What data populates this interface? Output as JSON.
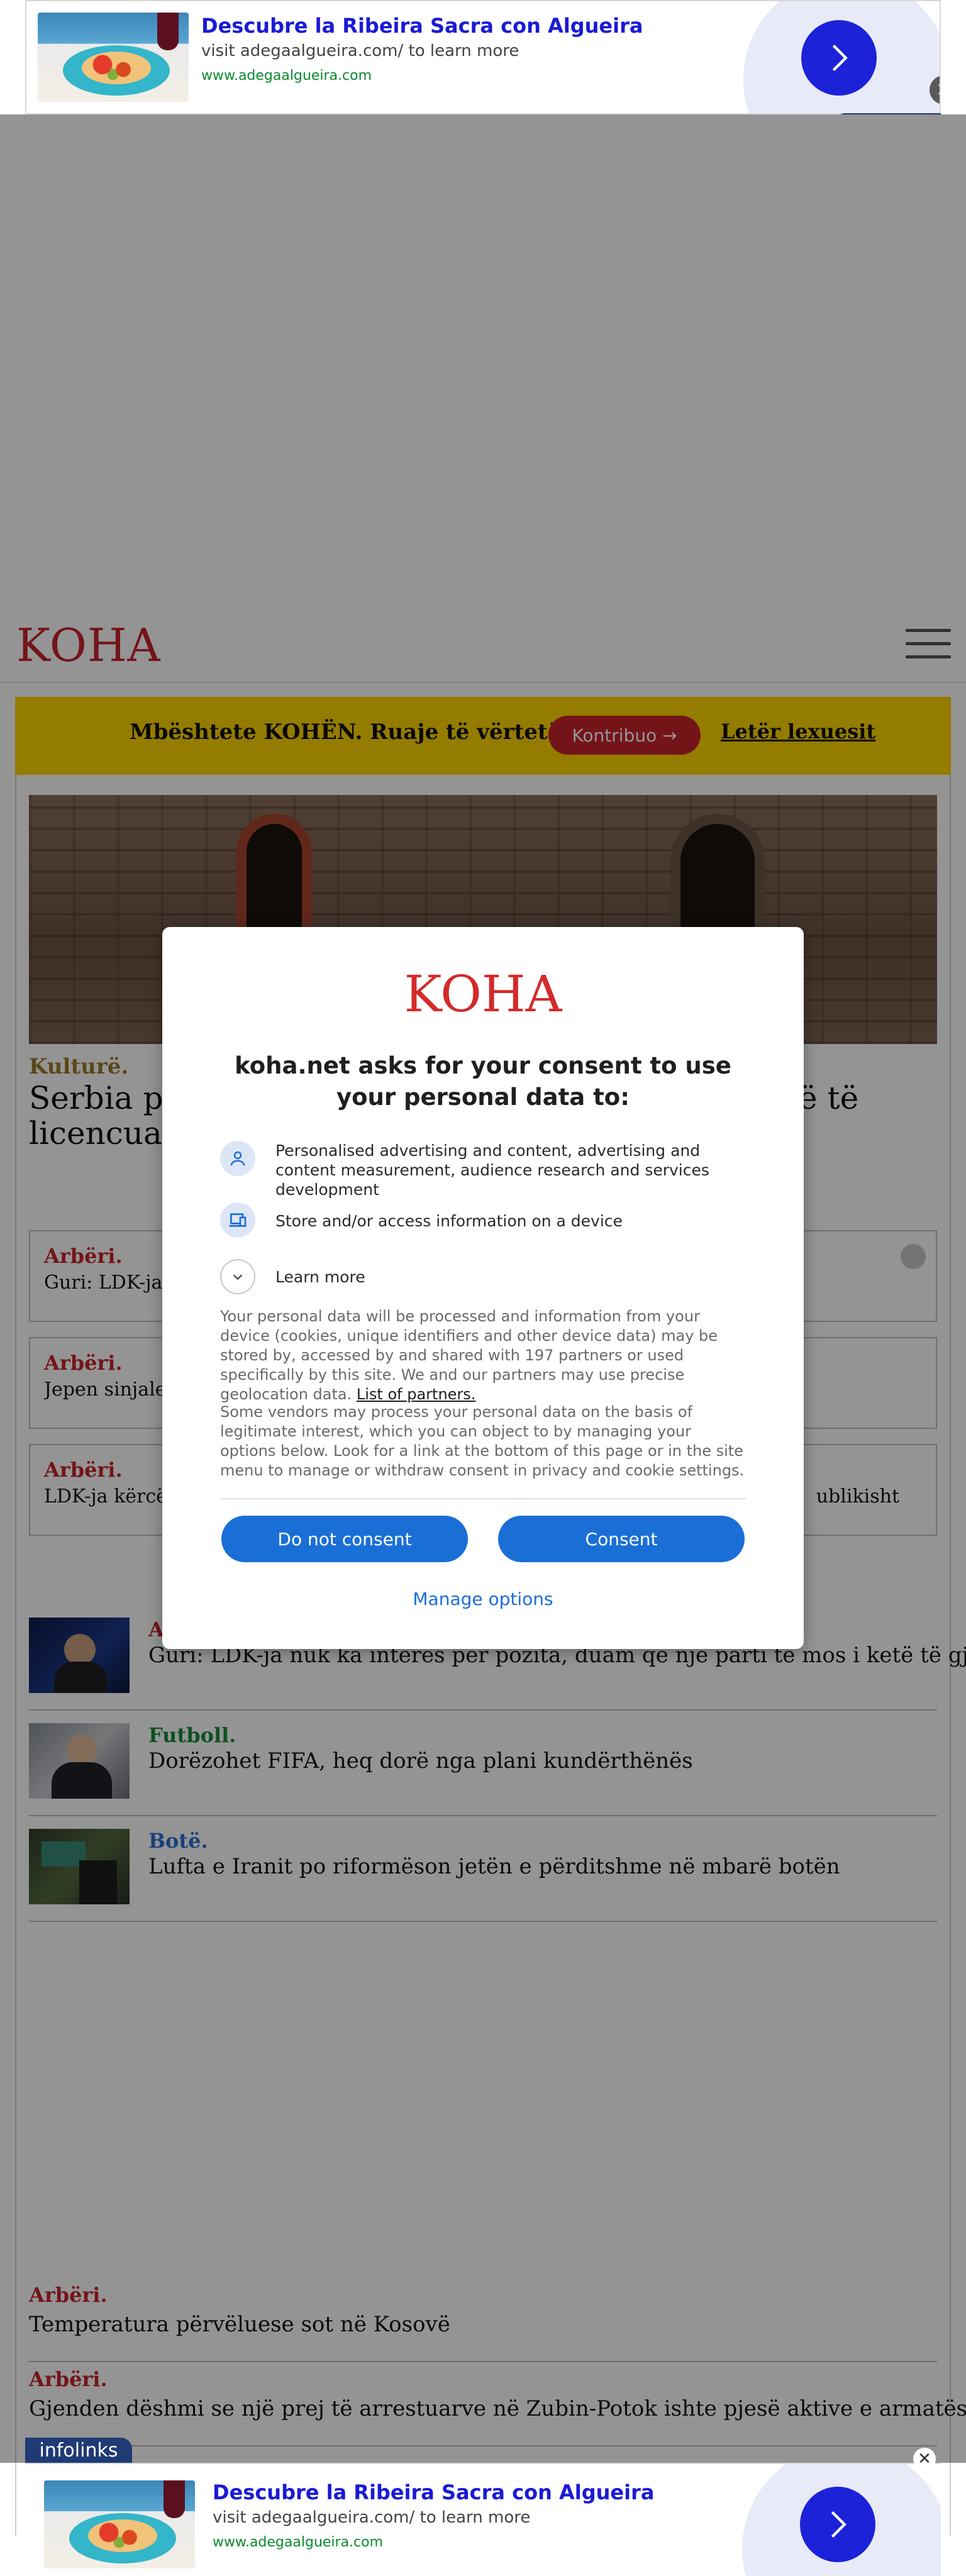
{
  "ad": {
    "title": "Descubre la Ribeira Sacra con Algueira",
    "subtitle": "visit adegaalgueira.com/ to learn more",
    "url": "www.adegaalgueira.com",
    "close_icon": "close-icon",
    "arrow_icon": "chevron-right-icon",
    "badge": "infolinks",
    "arrow_color": "#1c22d8"
  },
  "header": {
    "logo": "KOHA",
    "menu_icon": "hamburger-menu-icon",
    "brand_color": "#c8242b"
  },
  "support": {
    "text": "Mbështete KOHËN. Ruaje të vërtetën",
    "button": "Kontribuo →",
    "link": "Letër lexuesit",
    "color": "#ffd600"
  },
  "hero": {
    "category": "Kulturë.",
    "title_left": "Serbia po",
    "title_right": "ë të",
    "title_line2": "licencuar"
  },
  "boxed_items": [
    {
      "category": "Arbëri.",
      "title": "Guri: LDK-ja n",
      "title_right": ""
    },
    {
      "category": "Arbëri.",
      "title": "Jepen sinjale p",
      "title_right": ""
    },
    {
      "category": "Arbëri.",
      "title": "LDK-ja kërcë",
      "title_right": "ublikisht"
    }
  ],
  "list_items": [
    {
      "category": "A",
      "title": "Guri: LDK-ja nuk ka interes për pozita, duam që një parti të mos i ketë të gjitha",
      "color": "#c8242b"
    },
    {
      "category": "Futboll.",
      "title": "Dorëzohet FIFA, heq dorë nga plani kundërthënës",
      "color": "#1a8a3a"
    },
    {
      "category": "Botë.",
      "title": "Lufta e Iranit po riformëson jetën e përditshme në mbarë botën",
      "color": "#2a6fd6"
    }
  ],
  "bottom_items": [
    {
      "category": "Arbëri.",
      "title": "Temperatura përvëluese sot në Kosovë"
    },
    {
      "category": "Arbëri.",
      "title": "Gjenden dëshmi se një prej të arrestuarve në Zubin-Potok ishte pjesë aktive e armatës"
    }
  ],
  "consent": {
    "logo": "KOHA",
    "heading": "koha.net asks for your consent to use your personal data to:",
    "purposes": [
      {
        "icon": "person-icon",
        "text": "Personalised advertising and content, advertising and content measurement, audience research and services development"
      },
      {
        "icon": "devices-icon",
        "text": "Store and/or access information on a device"
      }
    ],
    "learn_more": "Learn more",
    "learn_icon": "chevron-down-icon",
    "paragraph1": "Your personal data will be processed and information from your device (cookies, unique identifiers and other device data) may be stored by, accessed by and shared with 197 partners or used specifically by this site. We and our partners may use precise geolocation data.",
    "partners_link": "List of partners.",
    "paragraph2": "Some vendors may process your personal data on the basis of legitimate interest, which you can object to by managing your options below. Look for a link at the bottom of this page or in the site menu to manage or withdraw consent in privacy and cookie settings.",
    "btn_decline": "Do not consent",
    "btn_accept": "Consent",
    "manage": "Manage options",
    "button_color": "#1a6fd6"
  }
}
